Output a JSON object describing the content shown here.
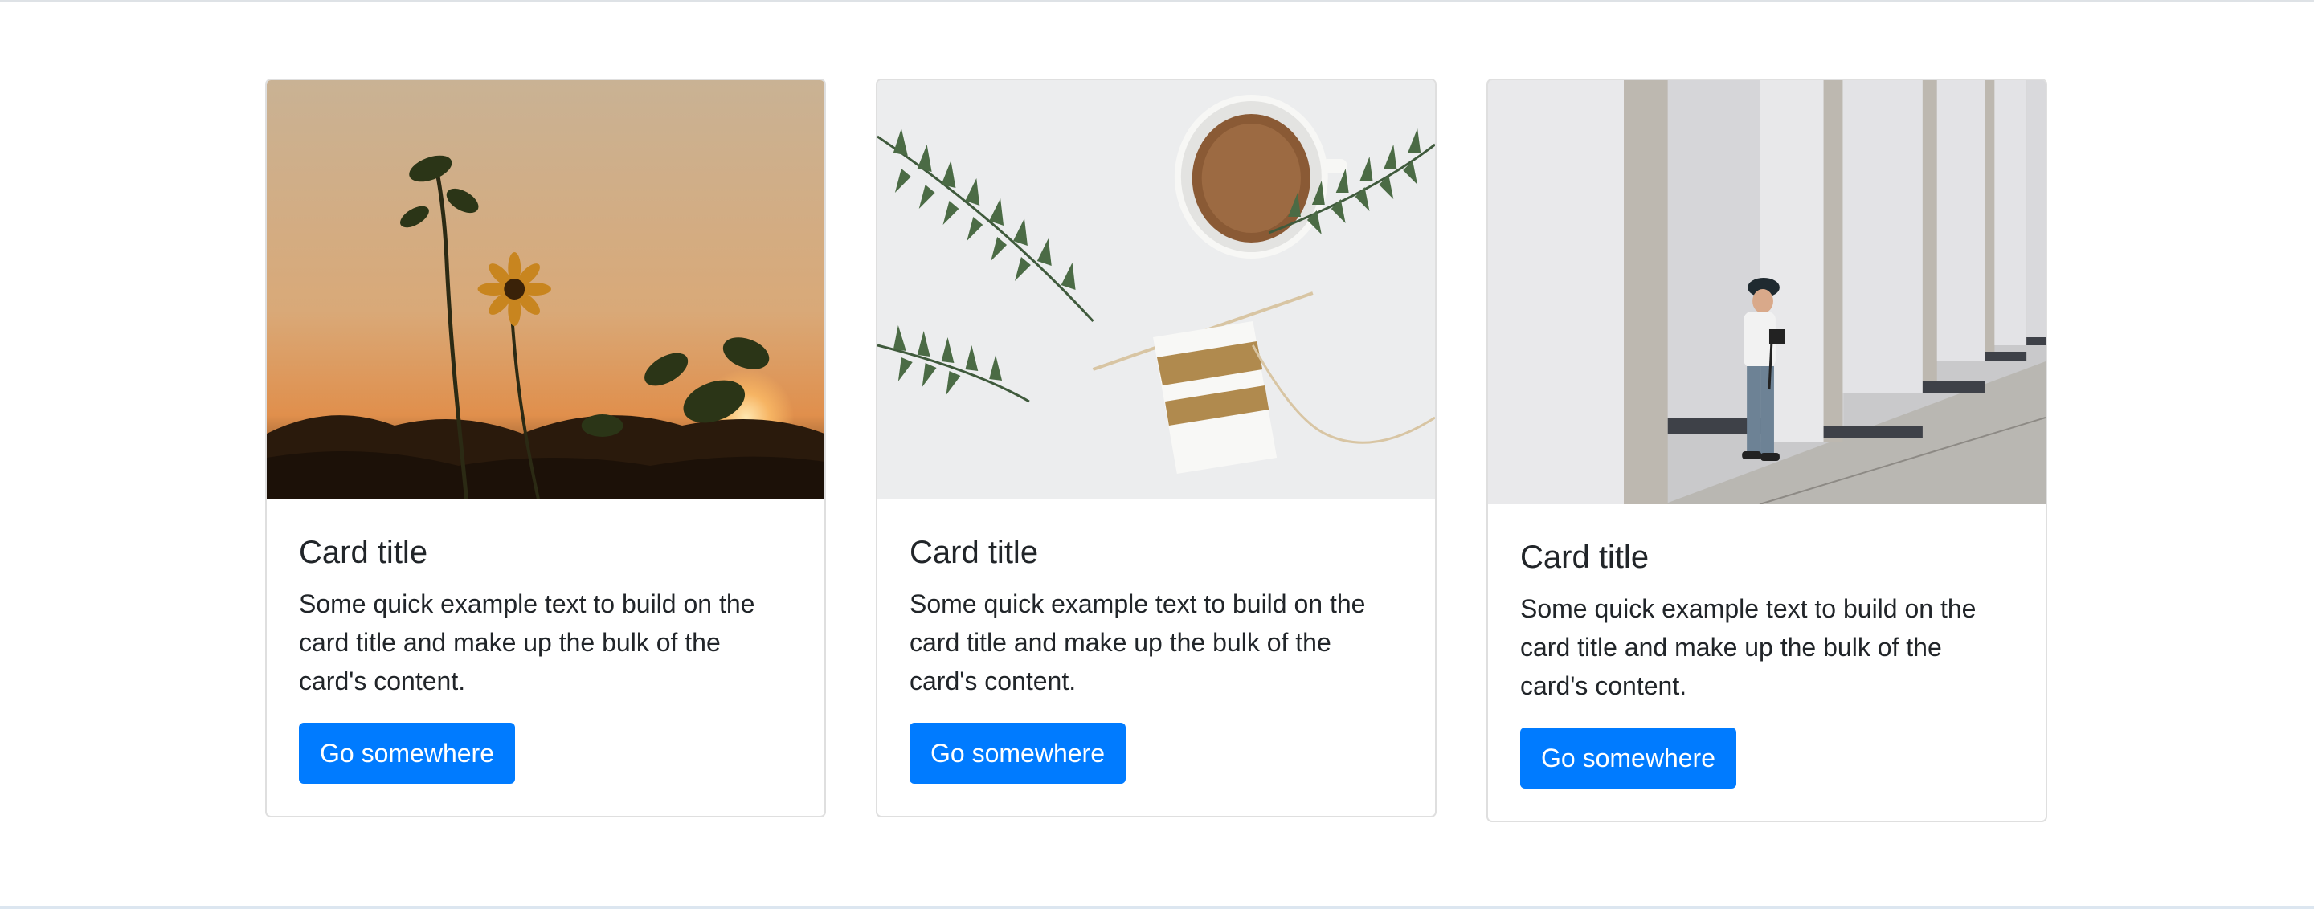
{
  "cards": [
    {
      "image": "sunflower-sunset-photo",
      "title": "Card title",
      "text": "Some quick example text to build on the card title and make up the bulk of the card's content.",
      "button_label": "Go somewhere"
    },
    {
      "image": "coffee-and-knitting-flatlay-photo",
      "title": "Card title",
      "text": "Some quick example text to build on the card title and make up the bulk of the card's content.",
      "button_label": "Go somewhere"
    },
    {
      "image": "photographer-colonnade-photo",
      "title": "Card title",
      "text": "Some quick example text to build on the card title and make up the bulk of the card's content.",
      "button_label": "Go somewhere"
    }
  ],
  "colors": {
    "button": "#007bff",
    "card_border": "#dfdfdf",
    "text": "#212529"
  }
}
